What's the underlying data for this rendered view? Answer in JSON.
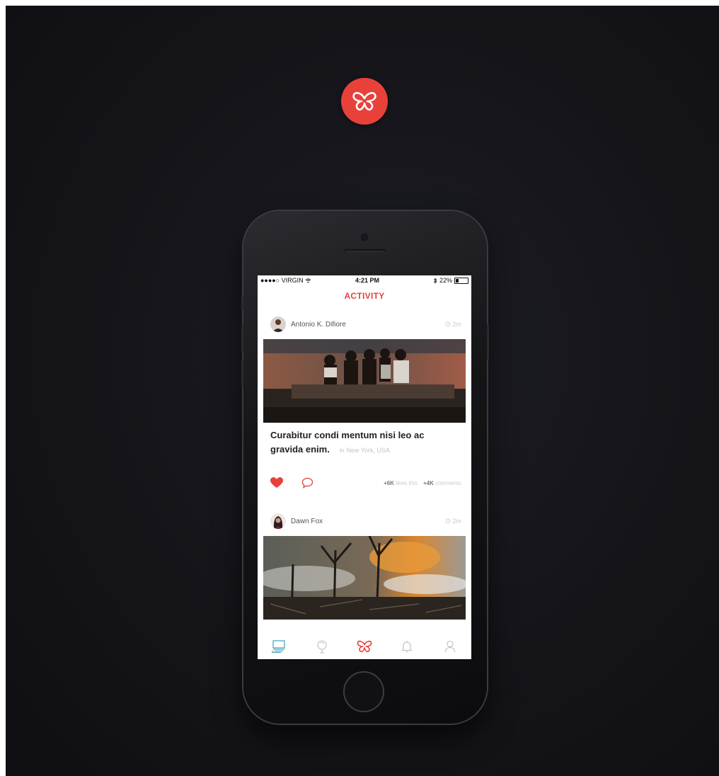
{
  "brand": {
    "accent_color": "#e8413a",
    "logo_icon": "butterfly-icon"
  },
  "status_bar": {
    "carrier": "●●●●○ VIRGIN",
    "time": "4:21 PM",
    "battery": "22%",
    "battery_level": 0.22
  },
  "screen": {
    "title": "ACTIVITY"
  },
  "posts": [
    {
      "author": "Antonio K. Difiore",
      "time": "2m",
      "caption_line1": "Curabitur condi mentum nisi leo ac",
      "caption_line2": "gravida enim.",
      "location": "in New York, USA",
      "likes_count": "+6K",
      "likes_label": "likes this",
      "comments_count": "+4K",
      "comments_label": "comments",
      "liked": true
    },
    {
      "author": "Dawn Fox",
      "time": "2m"
    }
  ],
  "tab_bar": {
    "tabs": [
      {
        "icon": "feed-icon",
        "active": true
      },
      {
        "icon": "explore-icon",
        "active": false
      },
      {
        "icon": "butterfly-icon",
        "active": false
      },
      {
        "icon": "bell-icon",
        "active": false
      },
      {
        "icon": "profile-icon",
        "active": false
      }
    ]
  }
}
